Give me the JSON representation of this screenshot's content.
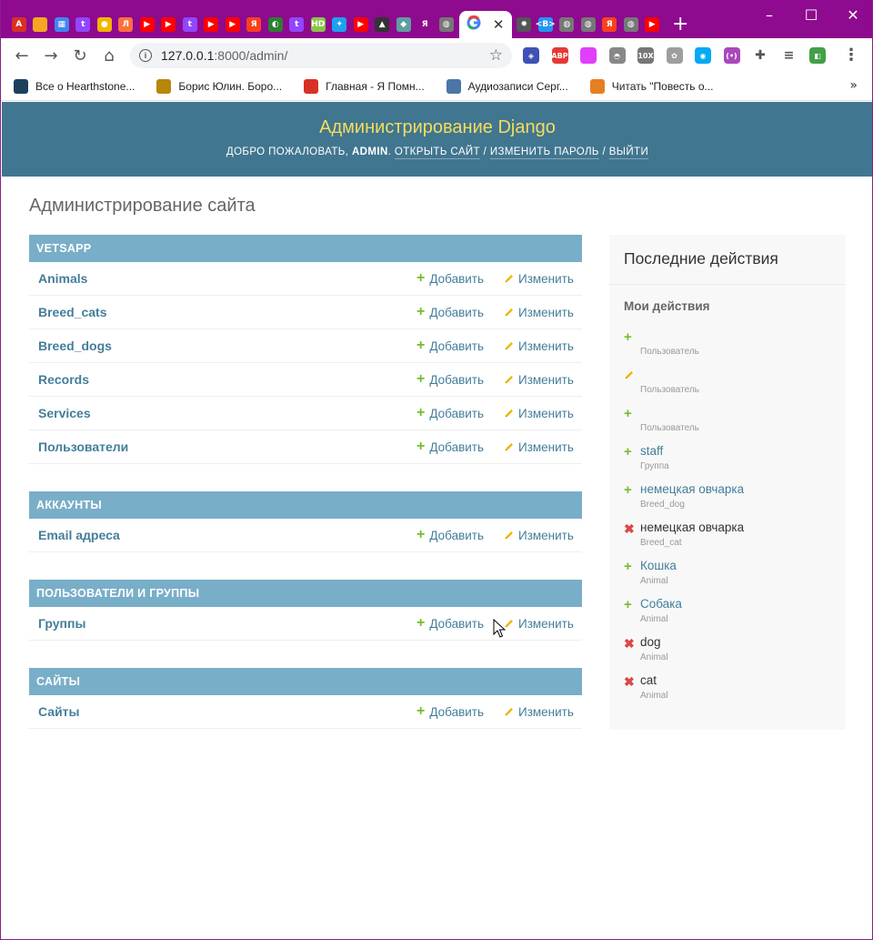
{
  "browser": {
    "tabs": [
      {
        "icon": "tab-a-favicon",
        "color": "#d93025",
        "glyph": "A"
      },
      {
        "icon": "tab-orange-favicon",
        "color": "#f5a623",
        "glyph": ""
      },
      {
        "icon": "tab-grid-favicon",
        "color": "#4285f4",
        "glyph": "▦"
      },
      {
        "icon": "tab-twitch-favicon",
        "color": "#9146ff",
        "glyph": "t"
      },
      {
        "icon": "tab-yellow-favicon",
        "color": "#f4b400",
        "glyph": "●"
      },
      {
        "icon": "tab-l-favicon",
        "color": "#ff6f3c",
        "glyph": "Л"
      },
      {
        "icon": "tab-youtube-favicon",
        "color": "#ff0000",
        "glyph": "▶"
      },
      {
        "icon": "tab-youtube-favicon",
        "color": "#ff0000",
        "glyph": "▶"
      },
      {
        "icon": "tab-twitch-favicon",
        "color": "#9146ff",
        "glyph": "t"
      },
      {
        "icon": "tab-youtube-favicon",
        "color": "#ff0000",
        "glyph": "▶"
      },
      {
        "icon": "tab-youtube-favicon",
        "color": "#ff0000",
        "glyph": "▶"
      },
      {
        "icon": "tab-yandex-favicon",
        "color": "#fc3f1d",
        "glyph": "Я"
      },
      {
        "icon": "tab-green-favicon",
        "color": "#2e7d32",
        "glyph": "◐"
      },
      {
        "icon": "tab-twitch-favicon",
        "color": "#9146ff",
        "glyph": "t"
      },
      {
        "icon": "tab-hd-favicon",
        "color": "#8bc34a",
        "glyph": "HD"
      },
      {
        "icon": "tab-twitter-favicon",
        "color": "#1da1f2",
        "glyph": "✦"
      },
      {
        "icon": "tab-youtube-favicon",
        "color": "#ff0000",
        "glyph": "▶"
      },
      {
        "icon": "tab-dark-favicon",
        "color": "#333333",
        "glyph": "▲"
      },
      {
        "icon": "tab-image-favicon",
        "color": "#5f9ea0",
        "glyph": "◆"
      },
      {
        "icon": "tab-yandex-favicon",
        "color": "#8e0a8e",
        "glyph": "Я"
      },
      {
        "icon": "tab-globe-favicon",
        "color": "#777777",
        "glyph": "◍"
      }
    ],
    "active_tab": {
      "icon": "google-favicon",
      "close_glyph": "✕"
    },
    "tabs_after": [
      {
        "icon": "tab-gear-favicon",
        "color": "#555555",
        "glyph": "✹"
      },
      {
        "icon": "tab-b-favicon",
        "color": "#2196f3",
        "glyph": "<B>"
      },
      {
        "icon": "tab-globe-favicon",
        "color": "#777777",
        "glyph": "◍"
      },
      {
        "icon": "tab-globe-favicon",
        "color": "#777777",
        "glyph": "◍"
      },
      {
        "icon": "tab-yandex-favicon",
        "color": "#fc3f1d",
        "glyph": "Я"
      },
      {
        "icon": "tab-globe-favicon",
        "color": "#777777",
        "glyph": "◍"
      },
      {
        "icon": "tab-youtube-favicon",
        "color": "#ff0000",
        "glyph": "▶"
      }
    ],
    "url_host": "127.0.0.1",
    "url_path": ":8000/admin/",
    "extensions": [
      {
        "icon": "ext-shield-icon",
        "color": "#3f51b5",
        "glyph": "◈"
      },
      {
        "icon": "adblock-icon",
        "color": "#e53935",
        "glyph": "ABP"
      },
      {
        "icon": "ext-gradient-icon",
        "color": "#e040fb",
        "glyph": ""
      },
      {
        "icon": "ext-tomato-icon",
        "color": "#888888",
        "glyph": "◓"
      },
      {
        "icon": "ext-10x-icon",
        "color": "#777777",
        "glyph": "10X"
      },
      {
        "icon": "ext-paw-icon",
        "color": "#9e9e9e",
        "glyph": "✿"
      },
      {
        "icon": "ext-search-icon",
        "color": "#03a9f4",
        "glyph": "◉"
      },
      {
        "icon": "ext-radio-icon",
        "color": "#ab47bc",
        "glyph": "(•)"
      },
      {
        "icon": "puzzle-icon",
        "color": "#555555",
        "glyph": "✚"
      },
      {
        "icon": "playlist-icon",
        "color": "#555555",
        "glyph": "≡"
      },
      {
        "icon": "ext-cat-icon",
        "color": "#43a047",
        "glyph": "◧"
      }
    ],
    "bookmarks": [
      {
        "label": "Все о Hearthstone...",
        "icon": "hearthstone-icon",
        "color": "#1c3f5e"
      },
      {
        "label": "Борис Юлин. Боро...",
        "icon": "bookmark-img-icon",
        "color": "#b8860b"
      },
      {
        "label": "Главная - Я Помн...",
        "icon": "yandex-icon",
        "color": "#d93025"
      },
      {
        "label": "Аудиозаписи Серг...",
        "icon": "vk-icon",
        "color": "#4a76a8"
      },
      {
        "label": "Читать \"Повесть о...",
        "icon": "book-icon",
        "color": "#e67e22"
      }
    ]
  },
  "header": {
    "brand": "Администрирование Django",
    "welcome": "Добро пожаловать,",
    "user": "admin",
    "dot": ".",
    "view_site": "Открыть сайт",
    "change_password": "Изменить пароль",
    "logout": "Выйти",
    "sep": "/"
  },
  "page_title": "Администрирование сайта",
  "add_label": "Добавить",
  "change_label": "Изменить",
  "modules": [
    {
      "caption": "Vetsapp",
      "models": [
        "Animals",
        "Breed_cats",
        "Breed_dogs",
        "Records",
        "Services",
        "Пользователи"
      ]
    },
    {
      "caption": "Аккаунты",
      "models": [
        "Email адреса"
      ]
    },
    {
      "caption": "Пользователи и группы",
      "models": [
        "Группы"
      ]
    },
    {
      "caption": "Сайты",
      "models": [
        "Сайты"
      ]
    }
  ],
  "recent": {
    "title": "Последние действия",
    "subtitle": "Мои действия",
    "actions": [
      {
        "kind": "add",
        "name": "",
        "type": "Пользователь",
        "link": true
      },
      {
        "kind": "change",
        "name": "",
        "type": "Пользователь",
        "link": true
      },
      {
        "kind": "add",
        "name": "",
        "type": "Пользователь",
        "link": true
      },
      {
        "kind": "add",
        "name": "staff",
        "type": "Группа",
        "link": true
      },
      {
        "kind": "add",
        "name": "немецкая овчарка",
        "type": "Breed_dog",
        "link": true
      },
      {
        "kind": "delete",
        "name": "немецкая овчарка",
        "type": "Breed_cat",
        "link": false
      },
      {
        "kind": "add",
        "name": "Кошка",
        "type": "Animal",
        "link": true
      },
      {
        "kind": "add",
        "name": "Собака",
        "type": "Animal",
        "link": true
      },
      {
        "kind": "delete",
        "name": "dog",
        "type": "Animal",
        "link": false
      },
      {
        "kind": "delete",
        "name": "cat",
        "type": "Animal",
        "link": false
      }
    ]
  },
  "colors": {
    "header_bg": "#417690",
    "brand": "#f5dd5d",
    "module_head": "#79aec8",
    "link": "#447e9b",
    "add_icon": "#70bf2b",
    "delete_icon": "#dd4646",
    "change_icon": "#efb80b",
    "browser_frame": "#8e0a8e"
  }
}
